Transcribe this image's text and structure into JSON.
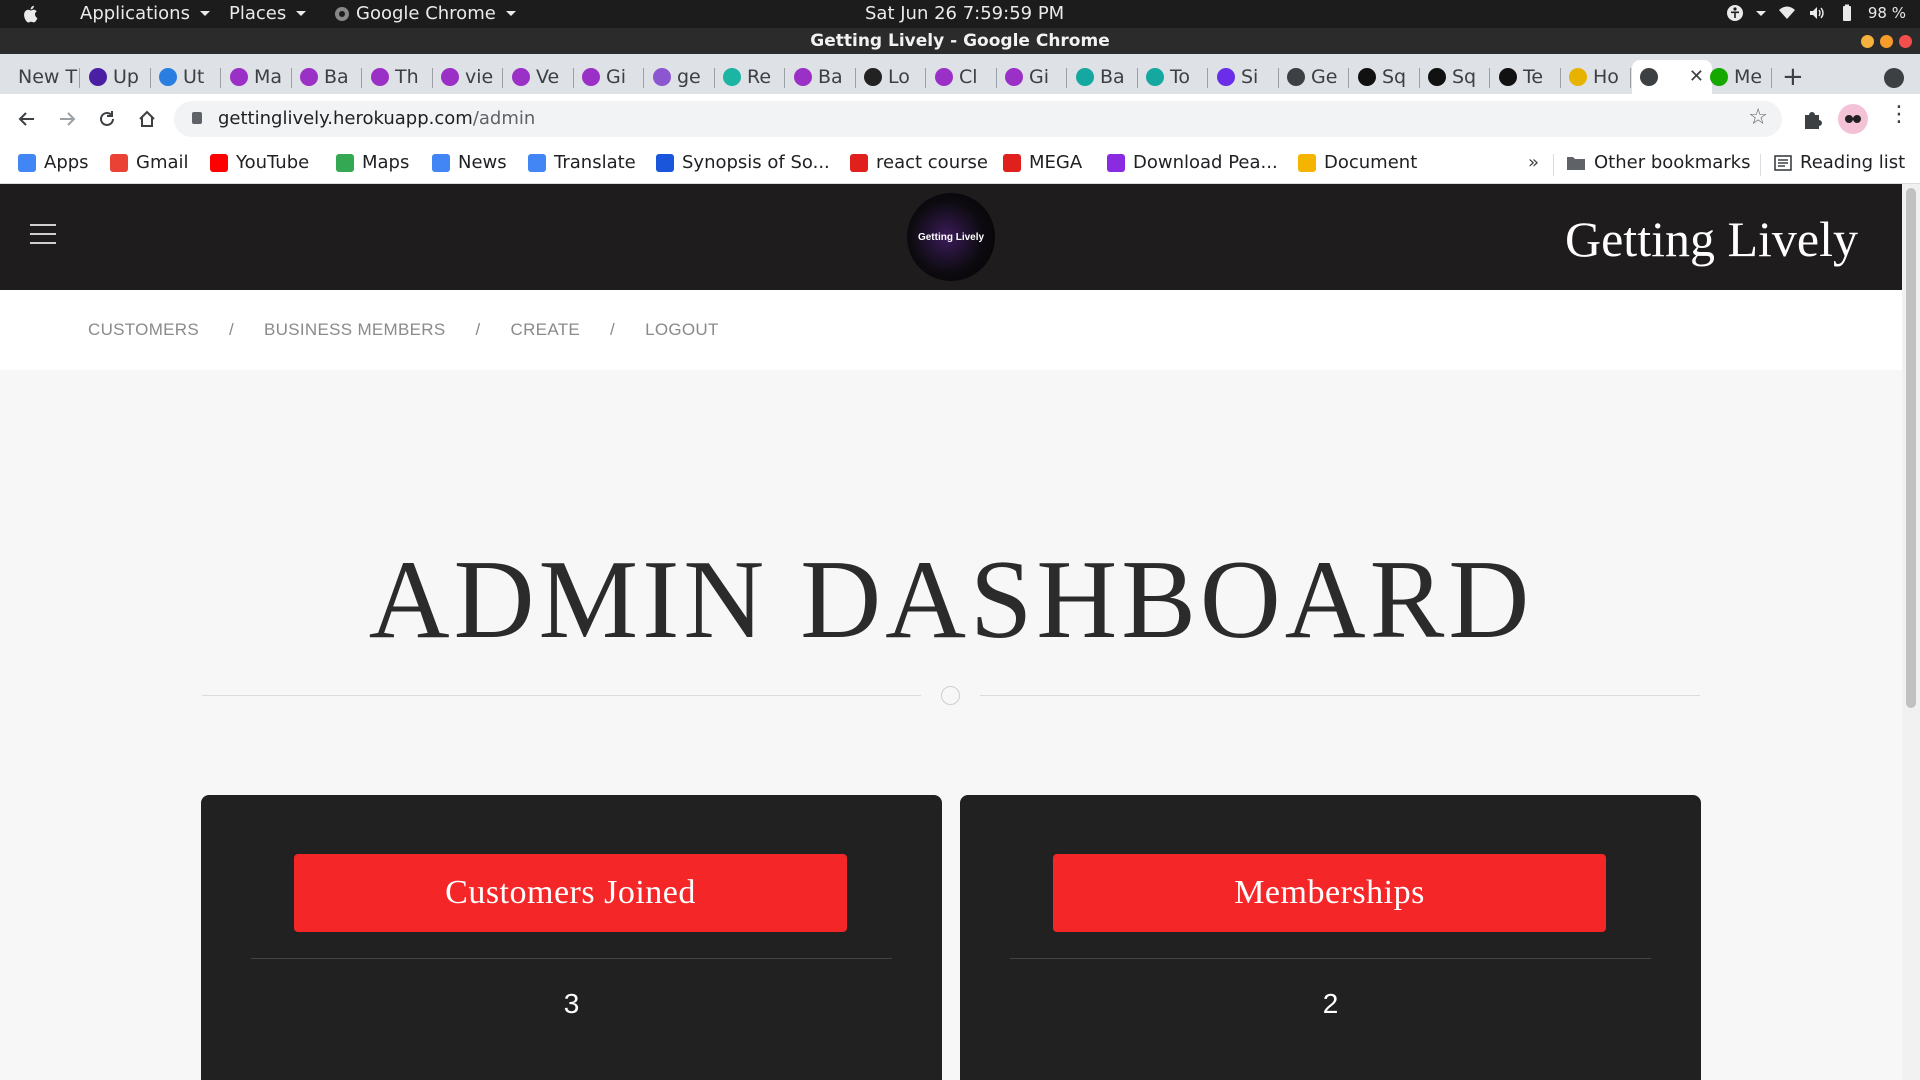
{
  "os": {
    "menus": [
      "Applications",
      "Places",
      "Google Chrome"
    ],
    "clock": "Sat Jun 26  7:59:59 PM",
    "battery": "98 %"
  },
  "window": {
    "title": "Getting Lively - Google Chrome"
  },
  "tabs": [
    {
      "label": "New T",
      "color": "#ffffff"
    },
    {
      "label": "Up",
      "color": "#4b1fa3"
    },
    {
      "label": "Ut",
      "color": "#2a7de1"
    },
    {
      "label": "Ma",
      "color": "#9b30c6"
    },
    {
      "label": "Ba",
      "color": "#9b30c6"
    },
    {
      "label": "Th",
      "color": "#9b30c6"
    },
    {
      "label": "vie",
      "color": "#9b30c6"
    },
    {
      "label": "Ve",
      "color": "#9b30c6"
    },
    {
      "label": "Gi",
      "color": "#9b30c6"
    },
    {
      "label": "ge",
      "color": "#8c56d1"
    },
    {
      "label": "Re",
      "color": "#1cb5a3"
    },
    {
      "label": "Ba",
      "color": "#9b30c6"
    },
    {
      "label": "Lo",
      "color": "#222222"
    },
    {
      "label": "Cl",
      "color": "#9b30c6"
    },
    {
      "label": "Gi",
      "color": "#9b30c6"
    },
    {
      "label": "Ba",
      "color": "#14a8a0"
    },
    {
      "label": "To",
      "color": "#14a8a0"
    },
    {
      "label": "Si",
      "color": "#6a2ee8"
    },
    {
      "label": "Ge",
      "color": "#3c4043"
    },
    {
      "label": "Sq",
      "color": "#111111"
    },
    {
      "label": "Sq",
      "color": "#111111"
    },
    {
      "label": "Te",
      "color": "#111111"
    },
    {
      "label": "Ho",
      "color": "#e6b400"
    },
    {
      "label": "",
      "color": "#3c4043"
    },
    {
      "label": "Me",
      "color": "#14a800"
    }
  ],
  "address": {
    "host": "gettinglively.herokuapp.com",
    "path": "/admin"
  },
  "bookmarks": [
    {
      "label": "Apps",
      "color": "#4285f4"
    },
    {
      "label": "Gmail",
      "color": "#ea4335"
    },
    {
      "label": "YouTube",
      "color": "#ff0000"
    },
    {
      "label": "Maps",
      "color": "#34a853"
    },
    {
      "label": "News",
      "color": "#4285f4"
    },
    {
      "label": "Translate",
      "color": "#4285f4"
    },
    {
      "label": "Synopsis of So...",
      "color": "#1a56db"
    },
    {
      "label": "react course",
      "color": "#e0201c"
    },
    {
      "label": "MEGA",
      "color": "#e0201c"
    },
    {
      "label": "Download Pea...",
      "color": "#8a2be2"
    },
    {
      "label": "Document",
      "color": "#f4b400"
    }
  ],
  "bookmarks_right": {
    "more": "»",
    "other": "Other bookmarks",
    "reading": "Reading list"
  },
  "site": {
    "logo_text": "Getting Lively",
    "brand": "Getting Lively",
    "nav": [
      "CUSTOMERS",
      "BUSINESS MEMBERS",
      "CREATE",
      "LOGOUT"
    ],
    "nav_separator": "/",
    "title": "ADMIN DASHBOARD",
    "cards": [
      {
        "label": "Customers Joined",
        "count": "3"
      },
      {
        "label": "Memberships",
        "count": "2"
      }
    ],
    "accent": "#f42628"
  }
}
